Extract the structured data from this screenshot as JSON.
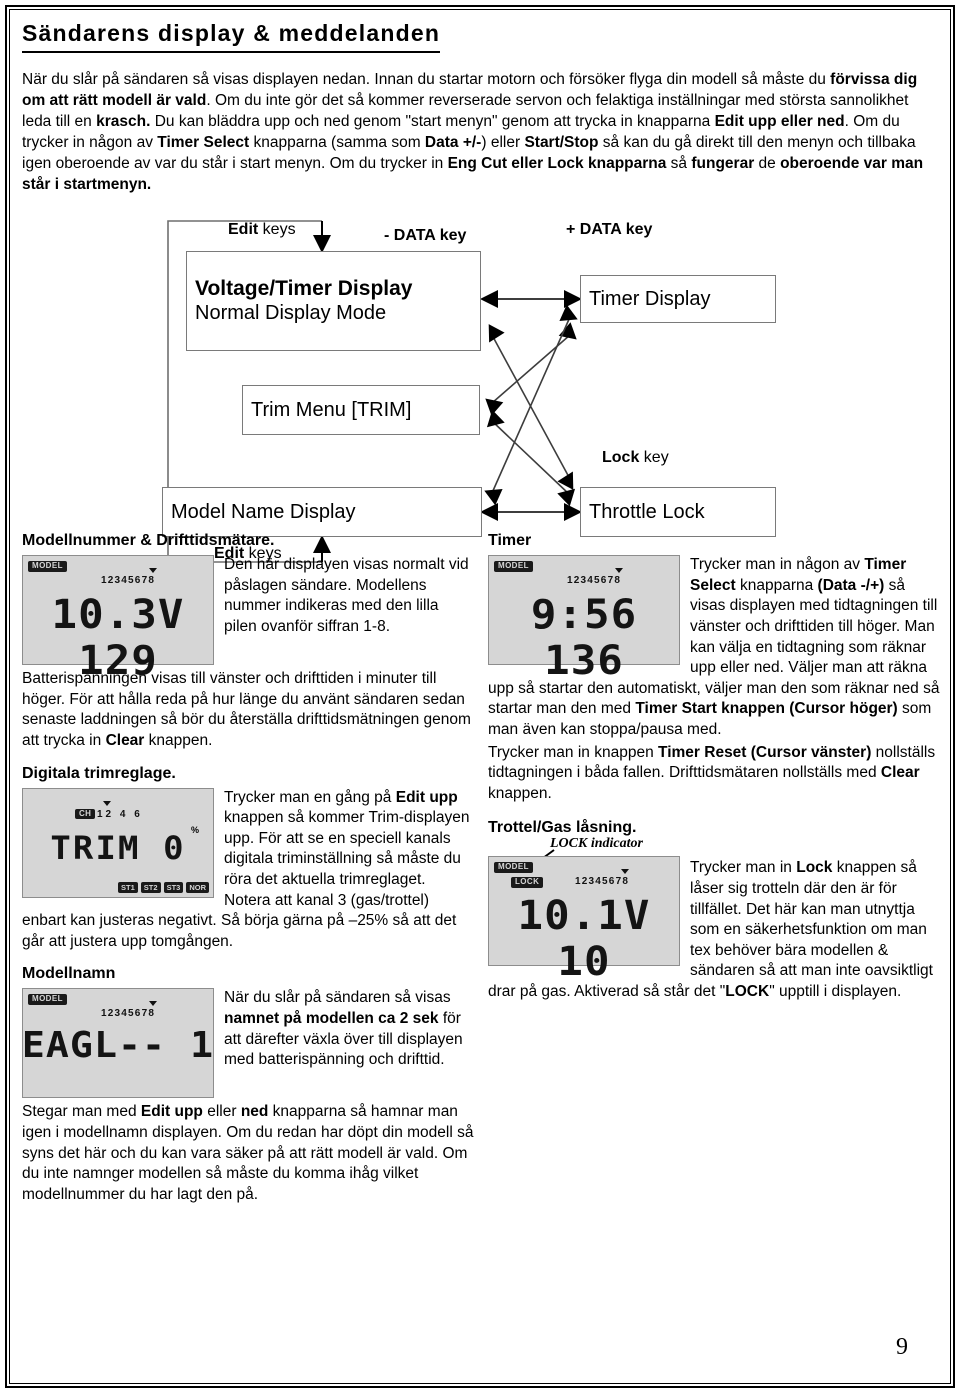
{
  "title": "Sändarens display & meddelanden",
  "intro": {
    "part1": "När du slår på sändaren så visas displayen nedan. Innan du startar motorn och försöker flyga din modell så måste du ",
    "b1": "förvissa dig om att rätt modell är vald",
    "part2": ". Om du inte gör det så kommer reverserade servon och felaktiga inställningar med största sannolikhet leda till en ",
    "b2": "krasch.",
    "part3": " Du kan bläddra upp och ned genom \"start menyn\" genom att trycka in knapparna ",
    "b3": "Edit upp eller ned",
    "part4": ". Om du trycker in någon av ",
    "b4": "Timer Select",
    "part5": " knapparna (samma som ",
    "b5": "Data +/-",
    "part6": ") eller ",
    "b6": "Start/Stop",
    "part7": " så kan du gå direkt till den menyn och tillbaka igen oberoende av var du står i start menyn. Om du trycker in ",
    "b7": "Eng Cut eller Lock knapparna",
    "part8": " så ",
    "b8": "fungerar",
    "part9": " de ",
    "b9": "oberoende var man står i startmenyn."
  },
  "diagram": {
    "labels": {
      "edit_keys_top": "Edit keys",
      "data_minus": "- DATA key",
      "data_plus": "+ DATA key",
      "lock_key": "Lock key",
      "edit_keys_bottom": "Edit keys"
    },
    "label_bold": {
      "edit": "Edit",
      "keys": " keys",
      "lock": "Lock",
      "key": " key"
    },
    "boxes": {
      "voltage_line1": "Voltage/Timer Display",
      "voltage_line2": "Normal Display Mode",
      "timer": "Timer Display",
      "trim": "Trim Menu [TRIM]",
      "model_name": "Model Name Display",
      "throttle_lock": "Throttle Lock"
    }
  },
  "left_column": {
    "sec1_title": "Modellnummer & Drifttidsmätare.",
    "lcd1": {
      "badge_model": "MODEL",
      "channels": "12345678",
      "value": "10.3V 129"
    },
    "sec1_p1": "Den här displayen visas normalt vid påslagen sändare. Modellens nummer indikeras med den lilla pilen ovanför siffran 1-8.",
    "sec1_p2a": "Batterispänningen visas till vänster och drifttiden i minuter till höger. För att hålla reda på hur länge du använt sändaren sedan senaste laddningen så bör du återställa drifttidsmätningen genom att trycka in ",
    "sec1_p2b": "Clear",
    "sec1_p2c": " knappen.",
    "sec2_title": "Digitala trimreglage.",
    "lcd2": {
      "badge_ch": "CH",
      "channels": "12 4 6",
      "value": "TRIM     0",
      "percent": "%",
      "status": [
        "ST1",
        "ST2",
        "ST3",
        "NOR"
      ]
    },
    "sec2_p1a": "Trycker man en gång på ",
    "sec2_p1b": "Edit upp",
    "sec2_p1c": " knappen så kommer Trim-displayen upp. För att se en speciell kanals digitala triminställning så måste du röra det aktuella trimreglaget. Notera att kanal 3 (gas/trottel) enbart kan justeras negativt. Så börja gärna på –25% så att det går att justera upp tomgången.",
    "sec3_title": "Modellnamn",
    "lcd3": {
      "badge_model": "MODEL",
      "channels": "12345678",
      "value": "EAGL-- 1"
    },
    "sec3_p1a": "När du slår på sändaren så visas ",
    "sec3_p1b": "namnet på modellen ca 2 sek",
    "sec3_p1c": " för att därefter växla över till displayen med batterispänning och drifttid.",
    "sec3_p2a": "Stegar man med ",
    "sec3_p2b": "Edit upp",
    "sec3_p2c": " eller ",
    "sec3_p2d": "ned",
    "sec3_p2e": " knapparna så hamnar man igen i modellnamn displayen. Om du redan har döpt din modell så syns det här och du kan vara säker på att rätt modell är vald. Om du inte namnger modellen så måste du komma ihåg vilket modellnummer du har lagt den på."
  },
  "right_column": {
    "sec1_title": "Timer",
    "lcd1": {
      "badge_model": "MODEL",
      "channels": "12345678",
      "value": "9:56 136"
    },
    "sec1_p1a": "Trycker man in någon av ",
    "sec1_p1b": "Timer Select",
    "sec1_p1c": " knapparna ",
    "sec1_p1d": "(Data -/+)",
    "sec1_p1e": " så visas displayen med tidtagningen till vänster och drifttiden till  höger. Man kan välja en tidtagning som räknar upp eller ned. Väljer man att räkna upp så startar den automatiskt, väljer man den som räknar ned så startar man den med ",
    "sec1_p1f": "Timer Start knappen (Cursor höger)",
    "sec1_p1g": " som man även kan stoppa/pausa med.",
    "sec1_p2a": "Trycker man in knappen ",
    "sec1_p2b": "Timer Reset (Cursor vänster)",
    "sec1_p2c": " nollställs tidtagningen i båda fallen. Drifttidsmätaren nollställs med ",
    "sec1_p2d": "Clear",
    "sec1_p2e": " knappen.",
    "sec2_title": "Trottel/Gas låsning.",
    "lcd2": {
      "badge_model": "MODEL",
      "badge_lock": "LOCK",
      "callout": "LOCK indicator",
      "channels": "12345678",
      "value": "10.1V 10"
    },
    "sec2_p1a": "Trycker man in ",
    "sec2_p1b": "Lock",
    "sec2_p1c": " knappen så låser sig trotteln där den är för tillfället. Det här kan man utnyttja som en säkerhetsfunktion om man tex behöver bära modellen & sändaren så att man inte oavsiktligt drar på gas. Aktiverad så står det \"",
    "sec2_p1d": "LOCK",
    "sec2_p1e": "\" upptill i displayen."
  },
  "page_number": "9"
}
